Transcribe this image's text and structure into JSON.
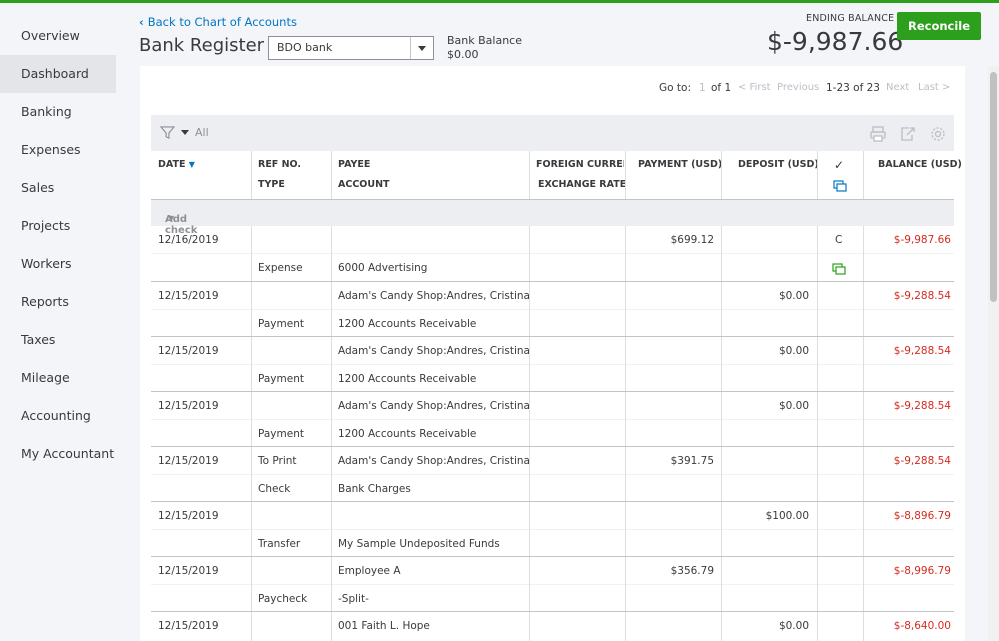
{
  "nav": [
    "Overview",
    "Dashboard",
    "Banking",
    "Expenses",
    "Sales",
    "Projects",
    "Workers",
    "Reports",
    "Taxes",
    "Mileage",
    "Accounting",
    "My Accountant"
  ],
  "header": {
    "back_link": "Back to Chart of Accounts",
    "title": "Bank Register",
    "account": "BDO bank",
    "bank_balance_label": "Bank Balance",
    "bank_balance_value": "$0.00",
    "ending_label": "ENDING BALANCE",
    "ending_value": "$-9,987.66",
    "reconcile": "Reconcile"
  },
  "pager": {
    "goto": "Go to:",
    "page": "1",
    "of": "of 1",
    "first": "< First",
    "previous": "Previous",
    "range": "1-23 of 23",
    "next": "Next",
    "last": "Last >"
  },
  "filter": {
    "label": "All"
  },
  "columns": {
    "date": "DATE",
    "ref": "REF NO.",
    "type": "TYPE",
    "payee": "PAYEE",
    "account": "ACCOUNT",
    "foreign": "FOREIGN CURRENCY",
    "exchange": "EXCHANGE RATE",
    "payment": "PAYMENT (USD)",
    "deposit": "DEPOSIT (USD)",
    "check": "✓",
    "balance": "BALANCE (USD)"
  },
  "add_check": "Add check",
  "rows": [
    {
      "date": "12/16/2019",
      "ref": "",
      "payee": "",
      "type": "Expense",
      "account": "6000 Advertising",
      "payment": "$699.12",
      "deposit": "",
      "status": "C",
      "balance": "$-9,987.66"
    },
    {
      "date": "12/15/2019",
      "ref": "",
      "payee": "Adam's Candy Shop:Andres, Cristina",
      "type": "Payment",
      "account": "1200 Accounts Receivable",
      "payment": "",
      "deposit": "$0.00",
      "status": "",
      "balance": "$-9,288.54"
    },
    {
      "date": "12/15/2019",
      "ref": "",
      "payee": "Adam's Candy Shop:Andres, Cristina",
      "type": "Payment",
      "account": "1200 Accounts Receivable",
      "payment": "",
      "deposit": "$0.00",
      "status": "",
      "balance": "$-9,288.54"
    },
    {
      "date": "12/15/2019",
      "ref": "",
      "payee": "Adam's Candy Shop:Andres, Cristina",
      "type": "Payment",
      "account": "1200 Accounts Receivable",
      "payment": "",
      "deposit": "$0.00",
      "status": "",
      "balance": "$-9,288.54"
    },
    {
      "date": "12/15/2019",
      "ref": "To Print",
      "payee": "Adam's Candy Shop:Andres, Cristina",
      "type": "Check",
      "account": "Bank Charges",
      "payment": "$391.75",
      "deposit": "",
      "status": "",
      "balance": "$-9,288.54"
    },
    {
      "date": "12/15/2019",
      "ref": "",
      "payee": "",
      "type": "Transfer",
      "account": "My Sample Undeposited Funds",
      "payment": "",
      "deposit": "$100.00",
      "status": "",
      "balance": "$-8,896.79"
    },
    {
      "date": "12/15/2019",
      "ref": "",
      "payee": "Employee A",
      "type": "Paycheck",
      "account": "-Split-",
      "payment": "$356.79",
      "deposit": "",
      "status": "",
      "balance": "$-8,996.79"
    },
    {
      "date": "12/15/2019",
      "ref": "",
      "payee": "001 Faith L. Hope",
      "type": "",
      "account": "",
      "payment": "",
      "deposit": "$0.00",
      "status": "",
      "balance": "$-8,640.00"
    }
  ]
}
